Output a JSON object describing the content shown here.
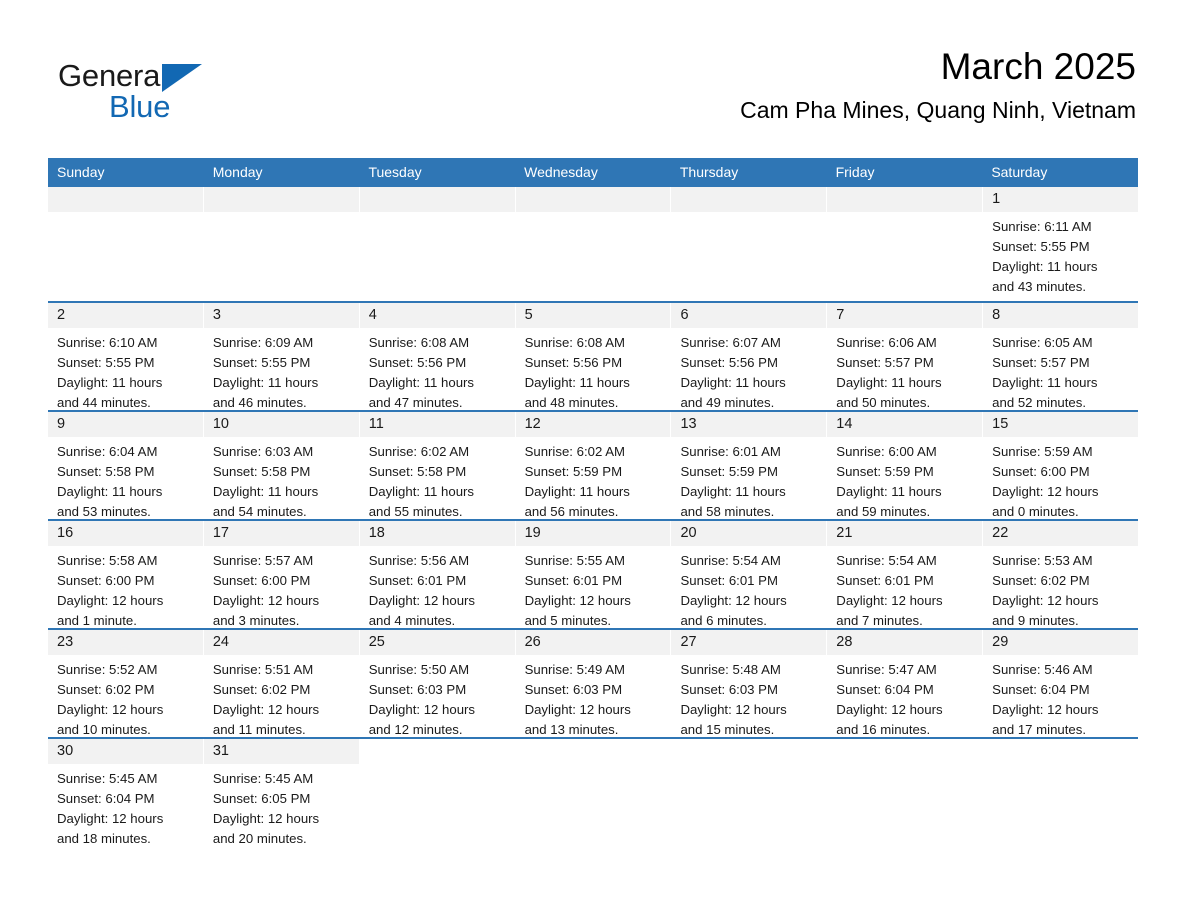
{
  "brand": {
    "name_part1": "General",
    "name_part2": "Blue",
    "triangle_color": "#1268b3",
    "blue_color": "#1268b3"
  },
  "header": {
    "title": "March 2025",
    "subtitle": "Cam Pha Mines, Quang Ninh, Vietnam"
  },
  "theme": {
    "header_blue": "#2f76b5",
    "daynum_bg": "#f2f2f2",
    "row_divider": "#2f76b5"
  },
  "calendar": {
    "weekday_headers": [
      "Sunday",
      "Monday",
      "Tuesday",
      "Wednesday",
      "Thursday",
      "Friday",
      "Saturday"
    ],
    "weeks": [
      [
        {
          "day": "",
          "empty": true
        },
        {
          "day": "",
          "empty": true
        },
        {
          "day": "",
          "empty": true
        },
        {
          "day": "",
          "empty": true
        },
        {
          "day": "",
          "empty": true
        },
        {
          "day": "",
          "empty": true
        },
        {
          "day": "1",
          "sunrise": "Sunrise: 6:11 AM",
          "sunset": "Sunset: 5:55 PM",
          "daylight_line1": "Daylight: 11 hours",
          "daylight_line2": "and 43 minutes."
        }
      ],
      [
        {
          "day": "2",
          "sunrise": "Sunrise: 6:10 AM",
          "sunset": "Sunset: 5:55 PM",
          "daylight_line1": "Daylight: 11 hours",
          "daylight_line2": "and 44 minutes."
        },
        {
          "day": "3",
          "sunrise": "Sunrise: 6:09 AM",
          "sunset": "Sunset: 5:55 PM",
          "daylight_line1": "Daylight: 11 hours",
          "daylight_line2": "and 46 minutes."
        },
        {
          "day": "4",
          "sunrise": "Sunrise: 6:08 AM",
          "sunset": "Sunset: 5:56 PM",
          "daylight_line1": "Daylight: 11 hours",
          "daylight_line2": "and 47 minutes."
        },
        {
          "day": "5",
          "sunrise": "Sunrise: 6:08 AM",
          "sunset": "Sunset: 5:56 PM",
          "daylight_line1": "Daylight: 11 hours",
          "daylight_line2": "and 48 minutes."
        },
        {
          "day": "6",
          "sunrise": "Sunrise: 6:07 AM",
          "sunset": "Sunset: 5:56 PM",
          "daylight_line1": "Daylight: 11 hours",
          "daylight_line2": "and 49 minutes."
        },
        {
          "day": "7",
          "sunrise": "Sunrise: 6:06 AM",
          "sunset": "Sunset: 5:57 PM",
          "daylight_line1": "Daylight: 11 hours",
          "daylight_line2": "and 50 minutes."
        },
        {
          "day": "8",
          "sunrise": "Sunrise: 6:05 AM",
          "sunset": "Sunset: 5:57 PM",
          "daylight_line1": "Daylight: 11 hours",
          "daylight_line2": "and 52 minutes."
        }
      ],
      [
        {
          "day": "9",
          "sunrise": "Sunrise: 6:04 AM",
          "sunset": "Sunset: 5:58 PM",
          "daylight_line1": "Daylight: 11 hours",
          "daylight_line2": "and 53 minutes."
        },
        {
          "day": "10",
          "sunrise": "Sunrise: 6:03 AM",
          "sunset": "Sunset: 5:58 PM",
          "daylight_line1": "Daylight: 11 hours",
          "daylight_line2": "and 54 minutes."
        },
        {
          "day": "11",
          "sunrise": "Sunrise: 6:02 AM",
          "sunset": "Sunset: 5:58 PM",
          "daylight_line1": "Daylight: 11 hours",
          "daylight_line2": "and 55 minutes."
        },
        {
          "day": "12",
          "sunrise": "Sunrise: 6:02 AM",
          "sunset": "Sunset: 5:59 PM",
          "daylight_line1": "Daylight: 11 hours",
          "daylight_line2": "and 56 minutes."
        },
        {
          "day": "13",
          "sunrise": "Sunrise: 6:01 AM",
          "sunset": "Sunset: 5:59 PM",
          "daylight_line1": "Daylight: 11 hours",
          "daylight_line2": "and 58 minutes."
        },
        {
          "day": "14",
          "sunrise": "Sunrise: 6:00 AM",
          "sunset": "Sunset: 5:59 PM",
          "daylight_line1": "Daylight: 11 hours",
          "daylight_line2": "and 59 minutes."
        },
        {
          "day": "15",
          "sunrise": "Sunrise: 5:59 AM",
          "sunset": "Sunset: 6:00 PM",
          "daylight_line1": "Daylight: 12 hours",
          "daylight_line2": "and 0 minutes."
        }
      ],
      [
        {
          "day": "16",
          "sunrise": "Sunrise: 5:58 AM",
          "sunset": "Sunset: 6:00 PM",
          "daylight_line1": "Daylight: 12 hours",
          "daylight_line2": "and 1 minute."
        },
        {
          "day": "17",
          "sunrise": "Sunrise: 5:57 AM",
          "sunset": "Sunset: 6:00 PM",
          "daylight_line1": "Daylight: 12 hours",
          "daylight_line2": "and 3 minutes."
        },
        {
          "day": "18",
          "sunrise": "Sunrise: 5:56 AM",
          "sunset": "Sunset: 6:01 PM",
          "daylight_line1": "Daylight: 12 hours",
          "daylight_line2": "and 4 minutes."
        },
        {
          "day": "19",
          "sunrise": "Sunrise: 5:55 AM",
          "sunset": "Sunset: 6:01 PM",
          "daylight_line1": "Daylight: 12 hours",
          "daylight_line2": "and 5 minutes."
        },
        {
          "day": "20",
          "sunrise": "Sunrise: 5:54 AM",
          "sunset": "Sunset: 6:01 PM",
          "daylight_line1": "Daylight: 12 hours",
          "daylight_line2": "and 6 minutes."
        },
        {
          "day": "21",
          "sunrise": "Sunrise: 5:54 AM",
          "sunset": "Sunset: 6:01 PM",
          "daylight_line1": "Daylight: 12 hours",
          "daylight_line2": "and 7 minutes."
        },
        {
          "day": "22",
          "sunrise": "Sunrise: 5:53 AM",
          "sunset": "Sunset: 6:02 PM",
          "daylight_line1": "Daylight: 12 hours",
          "daylight_line2": "and 9 minutes."
        }
      ],
      [
        {
          "day": "23",
          "sunrise": "Sunrise: 5:52 AM",
          "sunset": "Sunset: 6:02 PM",
          "daylight_line1": "Daylight: 12 hours",
          "daylight_line2": "and 10 minutes."
        },
        {
          "day": "24",
          "sunrise": "Sunrise: 5:51 AM",
          "sunset": "Sunset: 6:02 PM",
          "daylight_line1": "Daylight: 12 hours",
          "daylight_line2": "and 11 minutes."
        },
        {
          "day": "25",
          "sunrise": "Sunrise: 5:50 AM",
          "sunset": "Sunset: 6:03 PM",
          "daylight_line1": "Daylight: 12 hours",
          "daylight_line2": "and 12 minutes."
        },
        {
          "day": "26",
          "sunrise": "Sunrise: 5:49 AM",
          "sunset": "Sunset: 6:03 PM",
          "daylight_line1": "Daylight: 12 hours",
          "daylight_line2": "and 13 minutes."
        },
        {
          "day": "27",
          "sunrise": "Sunrise: 5:48 AM",
          "sunset": "Sunset: 6:03 PM",
          "daylight_line1": "Daylight: 12 hours",
          "daylight_line2": "and 15 minutes."
        },
        {
          "day": "28",
          "sunrise": "Sunrise: 5:47 AM",
          "sunset": "Sunset: 6:04 PM",
          "daylight_line1": "Daylight: 12 hours",
          "daylight_line2": "and 16 minutes."
        },
        {
          "day": "29",
          "sunrise": "Sunrise: 5:46 AM",
          "sunset": "Sunset: 6:04 PM",
          "daylight_line1": "Daylight: 12 hours",
          "daylight_line2": "and 17 minutes."
        }
      ],
      [
        {
          "day": "30",
          "sunrise": "Sunrise: 5:45 AM",
          "sunset": "Sunset: 6:04 PM",
          "daylight_line1": "Daylight: 12 hours",
          "daylight_line2": "and 18 minutes."
        },
        {
          "day": "31",
          "sunrise": "Sunrise: 5:45 AM",
          "sunset": "Sunset: 6:05 PM",
          "daylight_line1": "Daylight: 12 hours",
          "daylight_line2": "and 20 minutes."
        },
        {
          "day": "",
          "empty": true
        },
        {
          "day": "",
          "empty": true
        },
        {
          "day": "",
          "empty": true
        },
        {
          "day": "",
          "empty": true
        },
        {
          "day": "",
          "empty": true
        }
      ]
    ]
  }
}
